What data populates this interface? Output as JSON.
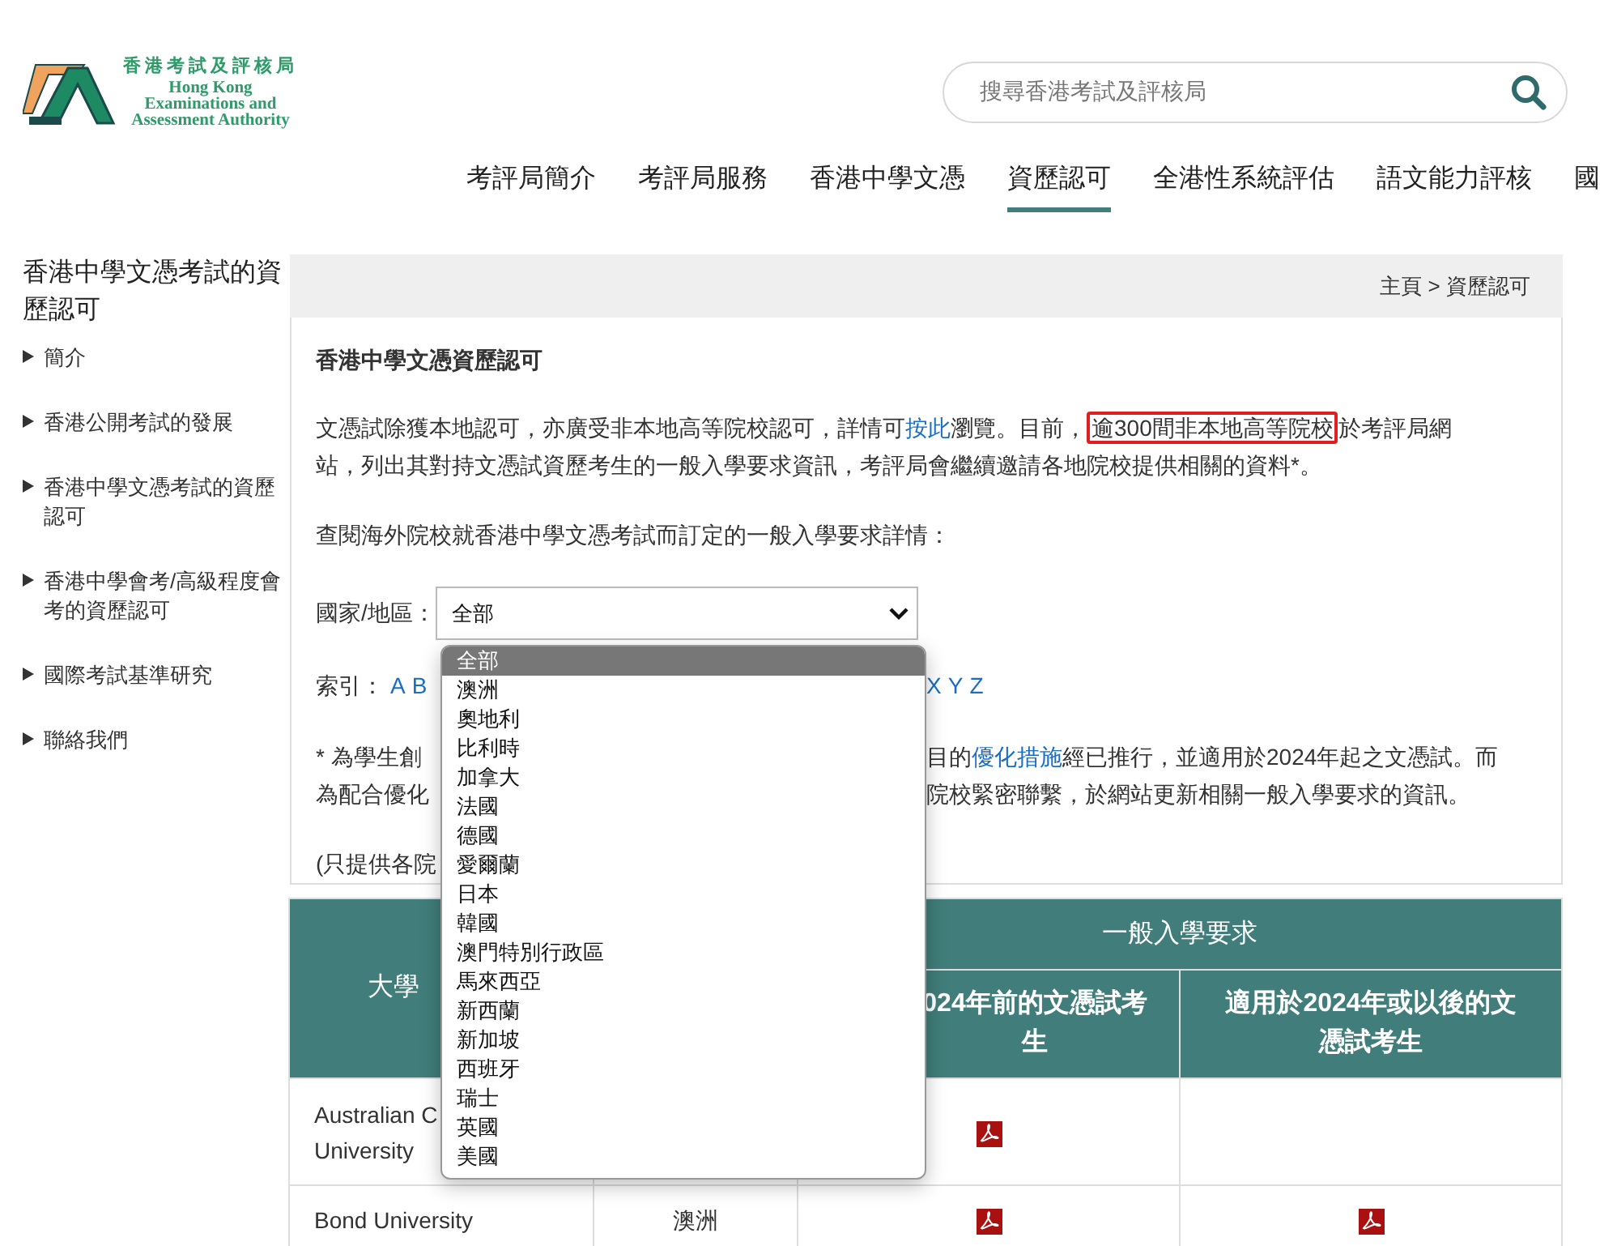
{
  "logo": {
    "chinese": "香港考試及評核局",
    "english": [
      "Hong Kong",
      "Examinations and",
      "Assessment Authority"
    ]
  },
  "search": {
    "placeholder": "搜尋香港考試及評核局"
  },
  "nav": [
    {
      "label": "考評局簡介",
      "selected": false
    },
    {
      "label": "考評局服務",
      "selected": false
    },
    {
      "label": "香港中學文憑",
      "selected": false
    },
    {
      "label": "資歷認可",
      "selected": true
    },
    {
      "label": "全港性系統評估",
      "selected": false
    },
    {
      "label": "語文能力評核",
      "selected": false
    },
    {
      "label": "國",
      "selected": false
    }
  ],
  "sidebar": {
    "title": "香港中學文憑考試的資歷認可",
    "items": [
      "簡介",
      "香港公開考試的發展",
      "香港中學文憑考試的資歷認可",
      "香港中學會考/高級程度會考的資歷認可",
      "國際考試基準研究",
      "聯絡我們"
    ]
  },
  "breadcrumb": "主頁 > 資歷認可",
  "content": {
    "title": "香港中學文憑資歷認可",
    "intro": {
      "before": "文憑試除獲本地認可，亦廣受非本地高等院校認可，詳情可",
      "link": "按此",
      "middle": "瀏覽。目前，",
      "highlight": "逾300間非本地高等院校",
      "after": "於考評局網站，列出其對持文憑試資歷考生的一般入學要求資訊，考評局會繼續邀請各地院校提供相關的資料*。"
    },
    "query": "查閱海外院校就香港中學文憑考試而訂定的一般入學要求詳情：",
    "filter": {
      "label": "國家/地區：",
      "value": "全部",
      "options": [
        {
          "label": "全部",
          "selected": true
        },
        {
          "label": "澳洲",
          "selected": false
        },
        {
          "label": "奧地利",
          "selected": false
        },
        {
          "label": "比利時",
          "selected": false
        },
        {
          "label": "加拿大",
          "selected": false
        },
        {
          "label": "法國",
          "selected": false
        },
        {
          "label": "德國",
          "selected": false
        },
        {
          "label": "愛爾蘭",
          "selected": false
        },
        {
          "label": "日本",
          "selected": false
        },
        {
          "label": "韓國",
          "selected": false
        },
        {
          "label": "澳門特別行政區",
          "selected": false
        },
        {
          "label": "馬來西亞",
          "selected": false
        },
        {
          "label": "新西蘭",
          "selected": false
        },
        {
          "label": "新加坡",
          "selected": false
        },
        {
          "label": "西班牙",
          "selected": false
        },
        {
          "label": "瑞士",
          "selected": false
        },
        {
          "label": "英國",
          "selected": false
        },
        {
          "label": "美國",
          "selected": false
        }
      ]
    },
    "index": {
      "label": "索引：",
      "letters_left": [
        "A",
        "B"
      ],
      "letters_right": [
        "X",
        "Y",
        "Z"
      ]
    },
    "footnote_lines": [
      {
        "left": "* 為學生創",
        "right_before": "目的",
        "right_link": "優化措施",
        "right_after": "經已推行，並適用於2024年起之文憑試。而"
      },
      {
        "left": "為配合優化",
        "right_before": "院校緊密聯繫，於網站更新相關一般入學要求的資訊。"
      }
    ],
    "note": "(只提供各院",
    "table": {
      "columns": {
        "column_1": "大學",
        "group": "一般入學要求",
        "column_3": "024年前的文憑試考生",
        "column_4": "適用於2024年或以後的文憑試考生"
      },
      "rows": [
        {
          "university": [
            "Australian C",
            "University"
          ],
          "column_3_pdf": true,
          "column_4_pdf": false
        },
        {
          "university": [
            "Bond University"
          ],
          "region": "澳洲",
          "column_3_pdf": true,
          "column_4_pdf": true
        }
      ]
    }
  }
}
